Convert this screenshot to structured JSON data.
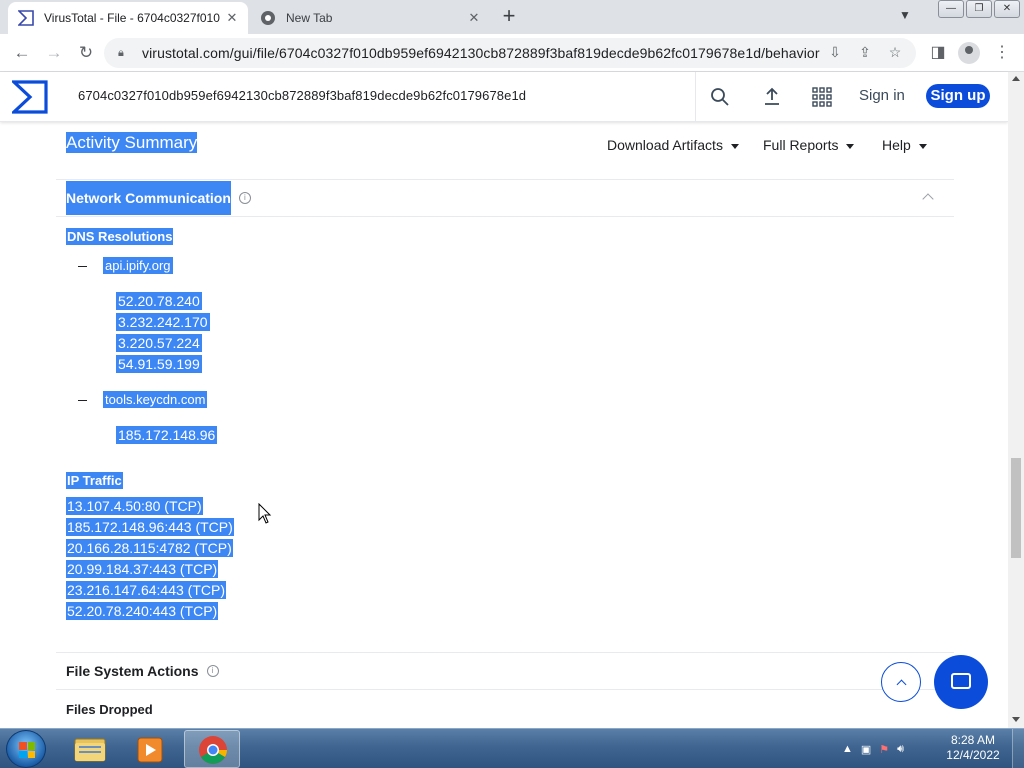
{
  "browser": {
    "tabs": [
      {
        "title": "VirusTotal - File - 6704c0327f010",
        "active": true
      },
      {
        "title": "New Tab",
        "active": false
      }
    ],
    "url": "virustotal.com/gui/file/6704c0327f010db959ef6942130cb872889f3baf819decde9b62fc0179678e1d/behavior"
  },
  "header": {
    "search_value": "6704c0327f010db959ef6942130cb872889f3baf819decde9b62fc0179678e1d",
    "sign_in": "Sign in",
    "sign_up": "Sign up"
  },
  "summary": {
    "title": "Activity Summary",
    "menus": [
      "Download Artifacts",
      "Full Reports",
      "Help"
    ]
  },
  "network": {
    "title": "Network Communication",
    "dns_title": "DNS Resolutions",
    "dns": [
      {
        "host": "api.ipify.org",
        "ips": [
          "52.20.78.240",
          "3.232.242.170",
          "3.220.57.224",
          "54.91.59.199"
        ]
      },
      {
        "host": "tools.keycdn.com",
        "ips": [
          "185.172.148.96"
        ]
      }
    ],
    "ip_title": "IP Traffic",
    "ip_traffic": [
      "13.107.4.50:80 (TCP)",
      "185.172.148.96:443 (TCP)",
      "20.166.28.115:4782 (TCP)",
      "20.99.184.37:443 (TCP)",
      "23.216.147.64:443 (TCP)",
      "52.20.78.240:443 (TCP)"
    ]
  },
  "file_system": {
    "title": "File System Actions",
    "files_dropped": "Files Dropped"
  },
  "taskbar": {
    "time": "8:28 AM",
    "date": "12/4/2022"
  },
  "colors": {
    "selection": "#3d87f5",
    "vt_blue": "#0b4dda"
  }
}
